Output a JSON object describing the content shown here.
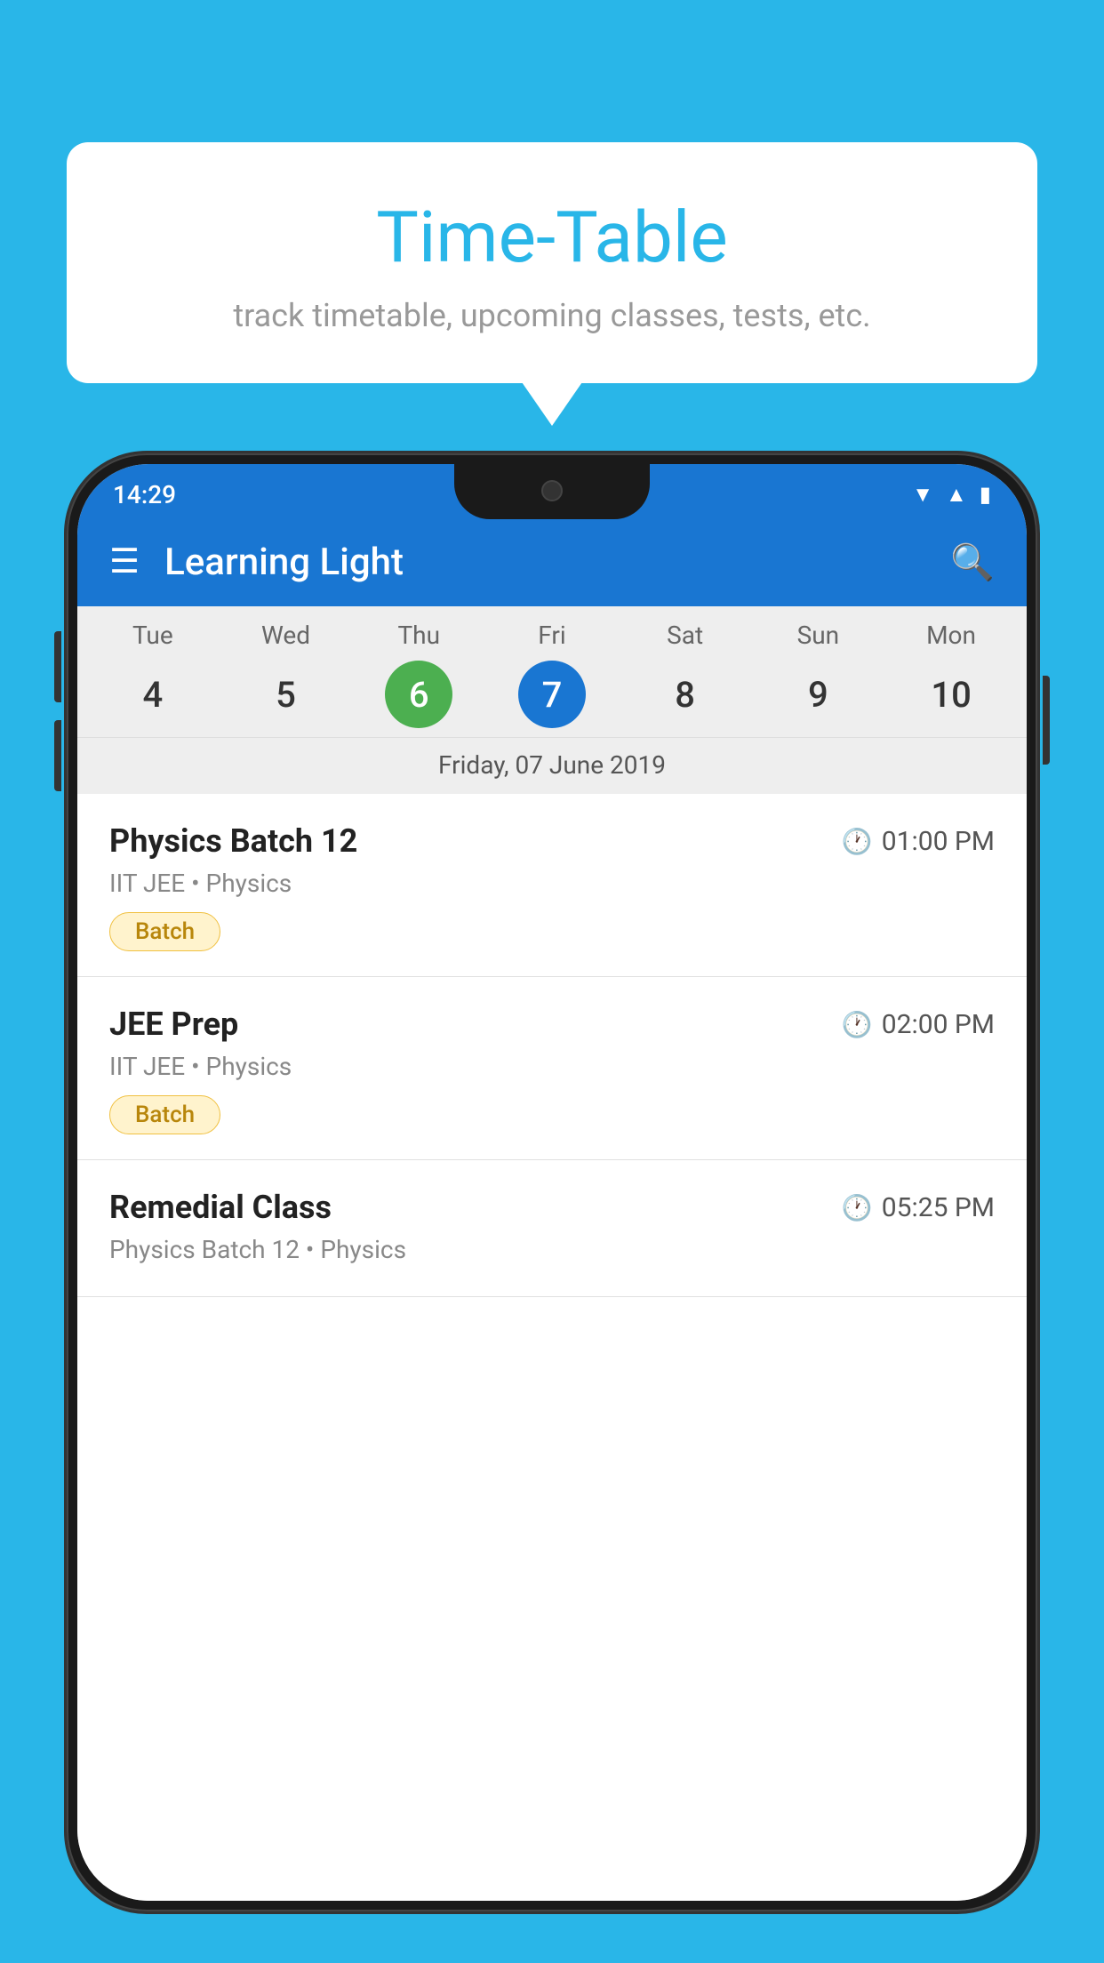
{
  "background_color": "#29b6e8",
  "tooltip": {
    "title": "Time-Table",
    "subtitle": "track timetable, upcoming classes, tests, etc."
  },
  "phone": {
    "status_bar": {
      "time": "14:29"
    },
    "app_bar": {
      "title": "Learning Light"
    },
    "calendar": {
      "days": [
        {
          "name": "Tue",
          "num": "4",
          "state": "normal"
        },
        {
          "name": "Wed",
          "num": "5",
          "state": "normal"
        },
        {
          "name": "Thu",
          "num": "6",
          "state": "today"
        },
        {
          "name": "Fri",
          "num": "7",
          "state": "selected"
        },
        {
          "name": "Sat",
          "num": "8",
          "state": "normal"
        },
        {
          "name": "Sun",
          "num": "9",
          "state": "normal"
        },
        {
          "name": "Mon",
          "num": "10",
          "state": "normal"
        }
      ],
      "selected_date_label": "Friday, 07 June 2019"
    },
    "schedule": [
      {
        "title": "Physics Batch 12",
        "time": "01:00 PM",
        "sub": "IIT JEE • Physics",
        "tag": "Batch"
      },
      {
        "title": "JEE Prep",
        "time": "02:00 PM",
        "sub": "IIT JEE • Physics",
        "tag": "Batch"
      },
      {
        "title": "Remedial Class",
        "time": "05:25 PM",
        "sub": "Physics Batch 12 • Physics",
        "tag": null
      }
    ]
  }
}
